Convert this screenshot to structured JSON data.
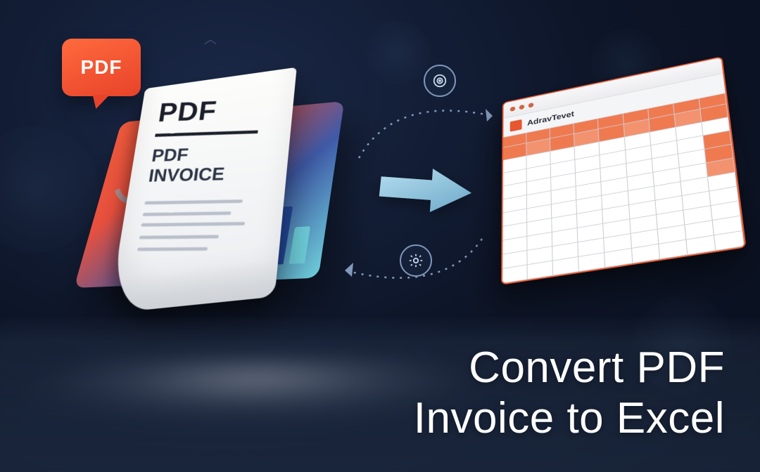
{
  "bubble_label": "PDF",
  "document": {
    "heading": "PDF",
    "subline1": "PDF",
    "subline2": "INVOICE"
  },
  "spreadsheet": {
    "ribbon_label": "AdravTevet"
  },
  "banner": {
    "line1": "Convert PDF",
    "line2": "Invoice to Excel"
  },
  "icons": {
    "target": "target-icon",
    "gear": "gear-icon"
  }
}
